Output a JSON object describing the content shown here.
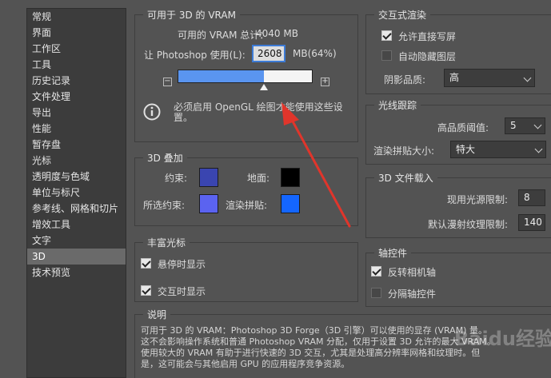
{
  "sidebar": {
    "items": [
      {
        "label": "常规"
      },
      {
        "label": "界面"
      },
      {
        "label": "工作区"
      },
      {
        "label": "工具"
      },
      {
        "label": "历史记录"
      },
      {
        "label": "文件处理"
      },
      {
        "label": "导出"
      },
      {
        "label": "性能"
      },
      {
        "label": "暂存盘"
      },
      {
        "label": "光标"
      },
      {
        "label": "透明度与色域"
      },
      {
        "label": "单位与标尺"
      },
      {
        "label": "参考线、网格和切片"
      },
      {
        "label": "增效工具"
      },
      {
        "label": "文字"
      },
      {
        "label": "3D"
      },
      {
        "label": "技术预览"
      }
    ]
  },
  "vram": {
    "title": "可用于 3D 的 VRAM",
    "total_label": "可用的 VRAM 总计：",
    "total_value": "4040 MB",
    "allow_label": "让 Photoshop 使用(L):",
    "allow_value": "2608",
    "allow_unit": "MB(64%)",
    "slider_percent": 64,
    "notice": "必须启用 OpenGL 绘图才能使用这些设置。"
  },
  "overlays": {
    "title": "3D 叠加",
    "constraint_label": "约束:",
    "ground_label": "地面:",
    "selected_constraint_label": "所选约束:",
    "render_tiles_label": "渲染拼贴:",
    "colors": {
      "constraint": "#3a45b0",
      "ground": "#000000",
      "selected_constraint": "#5b63f0",
      "render_tiles": "#1466ff"
    }
  },
  "rich_cursor": {
    "title": "丰富光标",
    "hover_label": "悬停时显示",
    "interact_label": "交互时显示",
    "hover_checked": true,
    "interact_checked": true
  },
  "description": {
    "title": "说明",
    "lines": [
      "可用于 3D 的 VRAM：Photoshop 3D Forge（3D 引擎）可以使用的显存 (VRAM) 量。",
      "这不会影响操作系统和普通 Photoshop VRAM 分配，仅用于设置 3D 允许的最大 VRAM。",
      "使用较大的 VRAM 有助于进行快速的 3D 交互，尤其是处理高分辨率网格和纹理时。但",
      "是，这可能会与其他启用 GPU 的应用程序竞争资源。"
    ]
  },
  "interactive_rendering": {
    "title": "交互式渲染",
    "allow_direct_write_label": "允许直接写屏",
    "auto_hide_layers_label": "自动隐藏图层",
    "allow_direct_write_checked": true,
    "auto_hide_layers_checked": false,
    "shadow_quality_label": "阴影品质:",
    "shadow_quality_value": "高"
  },
  "ray_tracing": {
    "title": "光线跟踪",
    "hq_threshold_label": "高品质阈值:",
    "hq_threshold_value": "5",
    "render_tile_size_label": "渲染拼贴大小:",
    "render_tile_size_value": "特大"
  },
  "file_load": {
    "title": "3D 文件载入",
    "light_limit_label": "现用光源限制:",
    "light_limit_value": "8",
    "diffuse_limit_label": "默认漫射纹理限制:",
    "diffuse_limit_value": "140"
  },
  "axis": {
    "title": "轴控件",
    "invert_camera_label": "反转相机轴",
    "separate_axis_label": "分隔轴控件",
    "invert_camera_checked": true,
    "separate_axis_checked": false
  },
  "watermark": "Baidu经验"
}
